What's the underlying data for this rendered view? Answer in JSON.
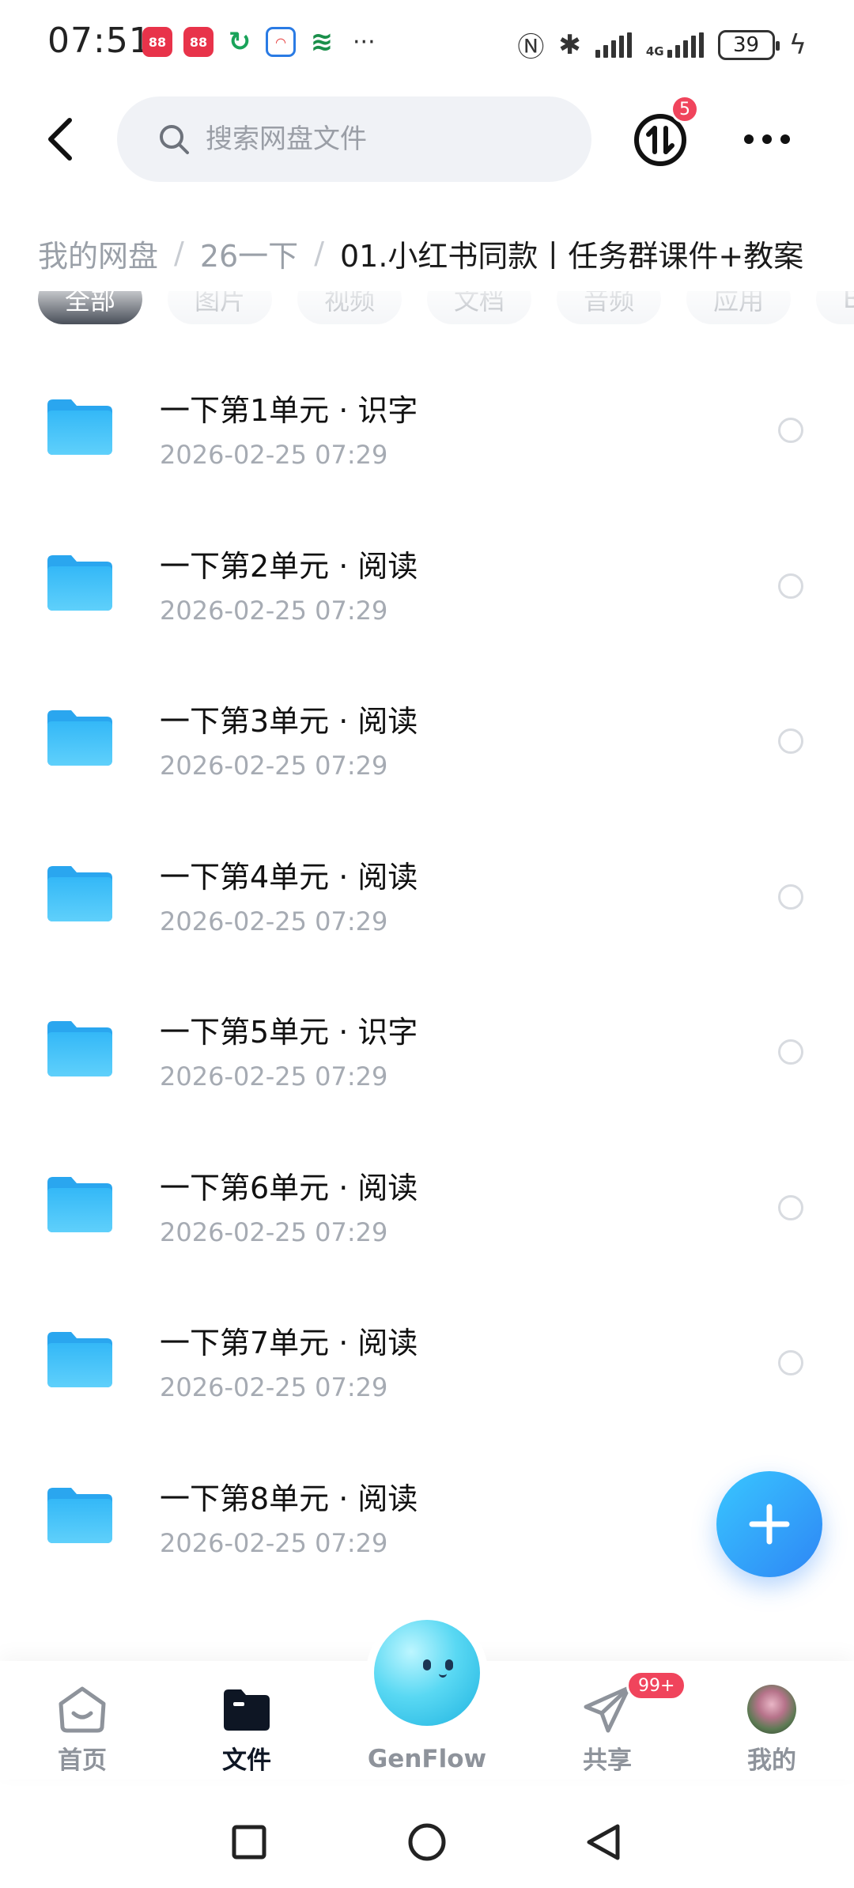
{
  "status_bar": {
    "time": "07:51",
    "app_badges": [
      "88",
      "88"
    ],
    "more": "···",
    "network": "4G",
    "battery": "39"
  },
  "header": {
    "search_placeholder": "搜索网盘文件",
    "transfer_badge": "5"
  },
  "breadcrumb": {
    "items": [
      "我的网盘",
      "26一下"
    ],
    "separator": "/",
    "current": "01.小红书同款丨任务群课件+教案"
  },
  "filters": [
    "全部",
    "图片",
    "视频",
    "文档",
    "音频",
    "应用",
    "BT"
  ],
  "files": [
    {
      "name": "一下第1单元 · 识字",
      "date": "2026-02-25  07:29"
    },
    {
      "name": "一下第2单元 · 阅读",
      "date": "2026-02-25  07:29"
    },
    {
      "name": "一下第3单元 · 阅读",
      "date": "2026-02-25  07:29"
    },
    {
      "name": "一下第4单元 · 阅读",
      "date": "2026-02-25  07:29"
    },
    {
      "name": "一下第5单元 · 识字",
      "date": "2026-02-25  07:29"
    },
    {
      "name": "一下第6单元 · 阅读",
      "date": "2026-02-25  07:29"
    },
    {
      "name": "一下第7单元 · 阅读",
      "date": "2026-02-25  07:29"
    },
    {
      "name": "一下第8单元 · 阅读",
      "date": "2026-02-25  07:29"
    }
  ],
  "fab": {
    "icon": "plus-icon"
  },
  "bottom_nav": {
    "home": "首页",
    "files": "文件",
    "genflow": "GenFlow",
    "share": "共享",
    "share_badge": "99+",
    "me": "我的"
  },
  "colors": {
    "accent": "#2e86f5",
    "badge": "#f0445c",
    "active_nav": "#0e1624",
    "muted_text": "#a6abb3"
  }
}
